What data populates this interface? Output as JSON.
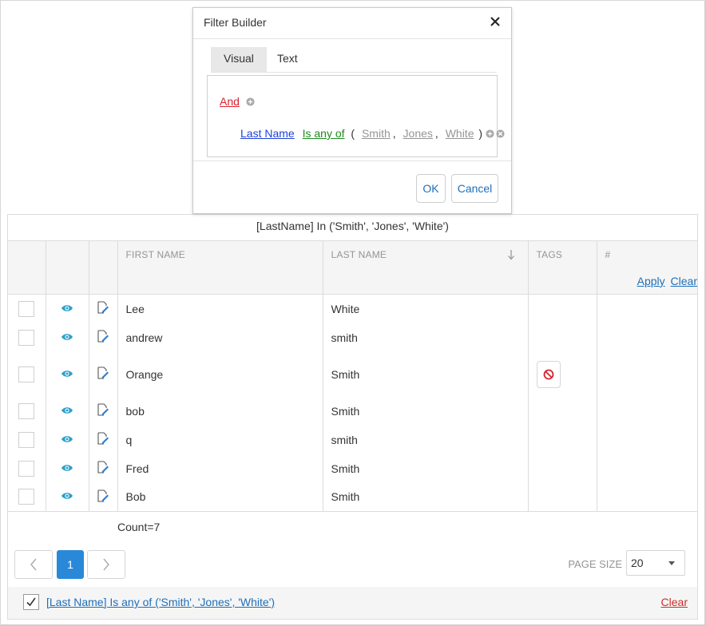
{
  "popup": {
    "title": "Filter Builder",
    "tabs": [
      {
        "label": "Visual",
        "active": true
      },
      {
        "label": "Text",
        "active": false
      }
    ],
    "group_operator": "And",
    "condition": {
      "field": "Last Name",
      "operator": "Is any of",
      "open": "(",
      "values": [
        "Smith",
        "Jones",
        "White"
      ],
      "sep": ",",
      "close": ")"
    },
    "ok_label": "OK",
    "cancel_label": "Cancel"
  },
  "grid": {
    "filter_expression": "[LastName] In ('Smith', 'Jones', 'White')",
    "columns": [
      "",
      "",
      "",
      "FIRST NAME",
      "LAST NAME",
      "TAGS",
      "#"
    ],
    "apply_label": "Apply",
    "clear_label": "Clear",
    "rows": [
      {
        "first": "Lee",
        "last": "White"
      },
      {
        "first": "andrew",
        "last": "smith"
      },
      {
        "first": "Orange",
        "last": "Smith"
      },
      {
        "first": "bob",
        "last": "Smith"
      },
      {
        "first": "q",
        "last": "smith"
      },
      {
        "first": "Fred",
        "last": "Smith"
      },
      {
        "first": "Bob",
        "last": "Smith"
      }
    ],
    "count_text": "Count=7"
  },
  "pager": {
    "current_page": "1",
    "page_size_label": "PAGE SIZE",
    "page_size": "20"
  },
  "filter_panel": {
    "text": "[Last Name] Is any of ('Smith', 'Jones', 'White')",
    "clear_label": "Clear"
  },
  "colors": {
    "accent": "#2a88d8",
    "link": "#1e6fb8",
    "group_red": "#d9232e",
    "field_blue": "#1f43d8",
    "operator_green": "#1d8b1d",
    "icon_teal": "#2a9fc9"
  }
}
